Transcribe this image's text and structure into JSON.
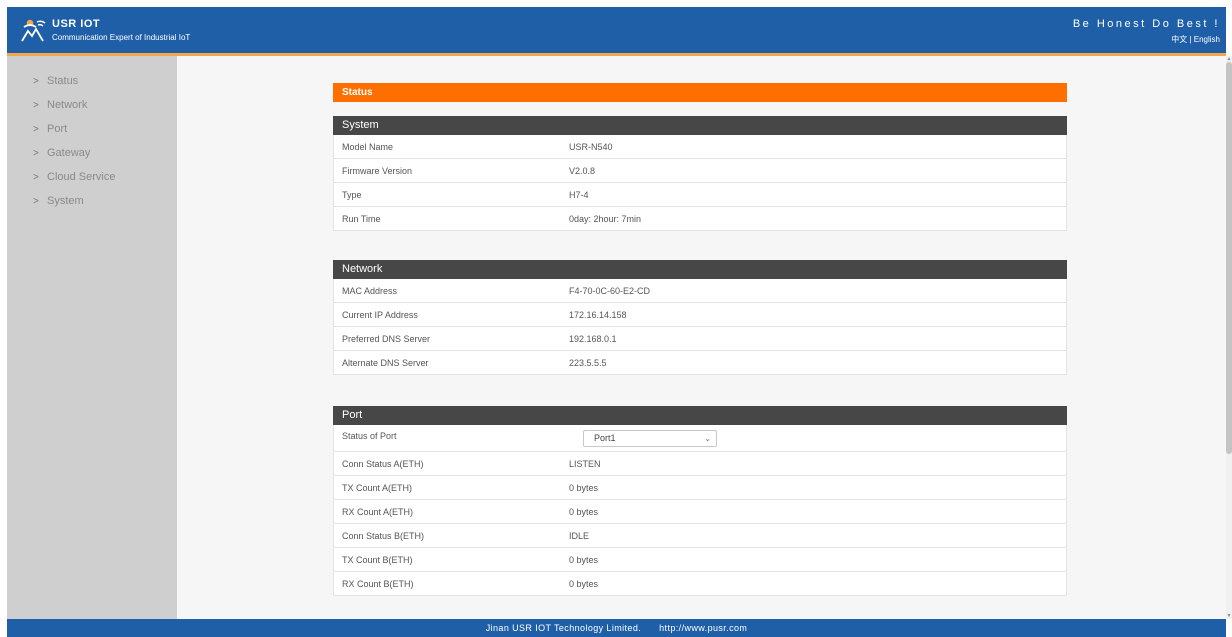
{
  "header": {
    "brand_name": "USR IOT",
    "brand_sub": "Communication Expert of Industrial IoT",
    "motto": "Be Honest Do Best !",
    "lang_zh": "中文",
    "lang_sep": "|",
    "lang_en": "English",
    "logo_icon": "usr-iot-logo-icon"
  },
  "sidebar": {
    "items": [
      {
        "label": "Status"
      },
      {
        "label": "Network"
      },
      {
        "label": "Port"
      },
      {
        "label": "Gateway"
      },
      {
        "label": "Cloud Service"
      },
      {
        "label": "System"
      }
    ],
    "chevron": ">"
  },
  "page_title": "Status",
  "system": {
    "title": "System",
    "rows": [
      {
        "label": "Model Name",
        "value": "USR-N540"
      },
      {
        "label": "Firmware Version",
        "value": "V2.0.8"
      },
      {
        "label": "Type",
        "value": "H7-4"
      },
      {
        "label": "Run Time",
        "value": "0day: 2hour: 7min"
      }
    ]
  },
  "network": {
    "title": "Network",
    "rows": [
      {
        "label": "MAC Address",
        "value": "F4-70-0C-60-E2-CD"
      },
      {
        "label": "Current IP Address",
        "value": "172.16.14.158"
      },
      {
        "label": "Preferred DNS Server",
        "value": "192.168.0.1"
      },
      {
        "label": "Alternate DNS Server",
        "value": "223.5.5.5"
      }
    ]
  },
  "port": {
    "title": "Port",
    "status_label": "Status of Port",
    "status_selected": "Port1",
    "rows": [
      {
        "label": "Conn Status A(ETH)",
        "value": "LISTEN"
      },
      {
        "label": "TX Count A(ETH)",
        "value": "0 bytes"
      },
      {
        "label": "RX Count A(ETH)",
        "value": "0 bytes"
      },
      {
        "label": "Conn Status B(ETH)",
        "value": "IDLE"
      },
      {
        "label": "TX Count B(ETH)",
        "value": "0 bytes"
      },
      {
        "label": "RX Count B(ETH)",
        "value": "0 bytes"
      }
    ]
  },
  "footer": {
    "company": "Jinan USR IOT Technology Limited.",
    "url": "http://www.pusr.com"
  },
  "colors": {
    "header_blue": "#1f5fa8",
    "accent_orange": "#ff6f00",
    "section_dark": "#474747",
    "sidebar_gray": "#cfcfcf"
  }
}
